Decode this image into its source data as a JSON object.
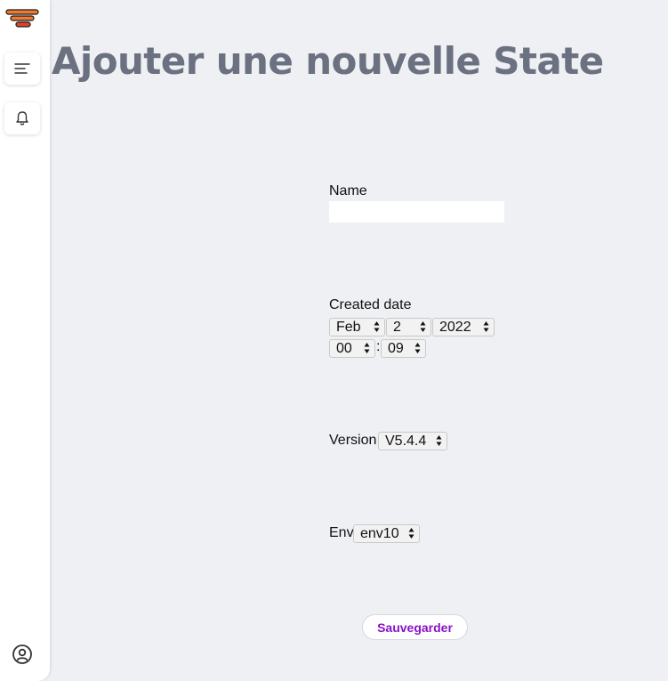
{
  "sidebar": {
    "logo_icon": "stacked-bars-logo",
    "brand_colors": [
      "#f07a2f",
      "#1a1a1a",
      "#e0452b"
    ],
    "items": [
      {
        "icon": "menu-lines-icon"
      },
      {
        "icon": "bell-icon"
      }
    ],
    "footer_icon": "account-circle-icon"
  },
  "page": {
    "title": "Ajouter une nouvelle State"
  },
  "form": {
    "name": {
      "label": "Name",
      "value": ""
    },
    "created_date": {
      "label": "Created date",
      "month": "Feb",
      "day": "2",
      "year": "2022",
      "hour": "00",
      "separator": ":",
      "minute": "09"
    },
    "version": {
      "label": "Version",
      "value": "V5.4.4"
    },
    "env": {
      "label": "Env",
      "value": "env10"
    },
    "save_label": "Sauvegarder"
  },
  "colors": {
    "background": "#eef0f3",
    "title": "#6b7180",
    "save_text": "#8a10c9"
  }
}
